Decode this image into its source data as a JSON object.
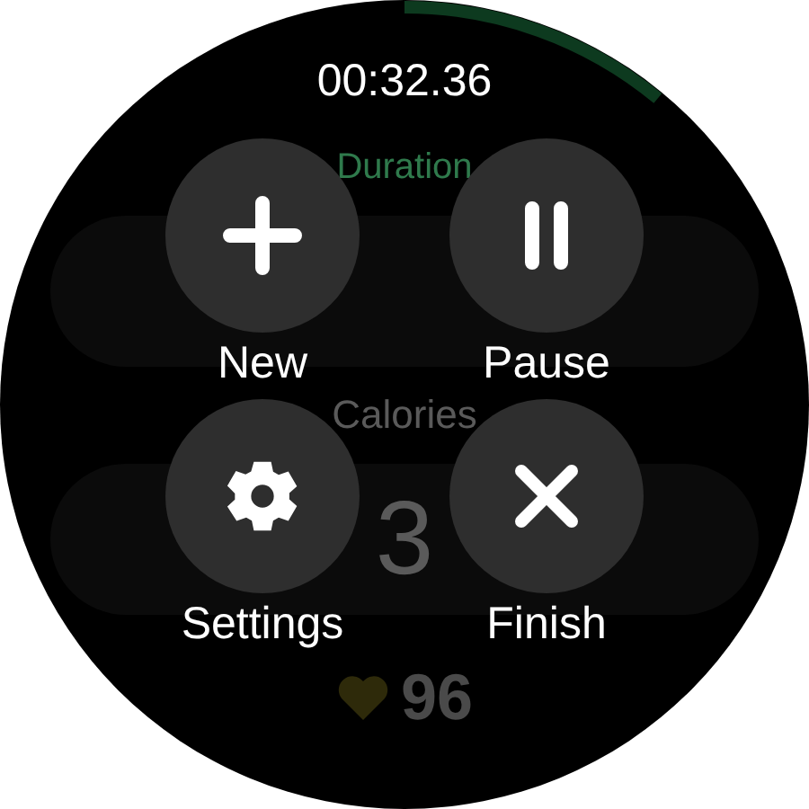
{
  "timer": "00:32.36",
  "workout": {
    "duration_label": "Duration",
    "calories_label": "Calories",
    "calories_value": "3",
    "heart_rate": "96"
  },
  "actions": [
    {
      "kind": "plus",
      "label": "New"
    },
    {
      "kind": "pause",
      "label": "Pause"
    },
    {
      "kind": "gear",
      "label": "Settings"
    },
    {
      "kind": "close",
      "label": "Finish"
    }
  ]
}
